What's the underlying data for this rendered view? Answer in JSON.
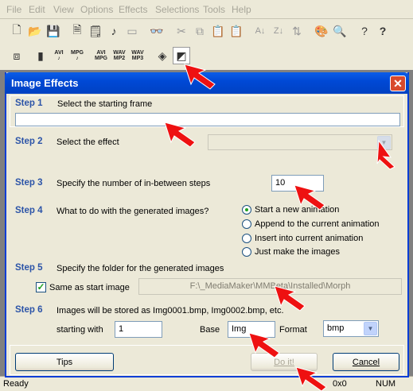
{
  "menu": [
    "File",
    "Edit",
    "View",
    "Options",
    "Effects",
    "Selections",
    "Tools",
    "Help"
  ],
  "toolbar2": [
    {
      "top": "AVI",
      "bottom": "♪"
    },
    {
      "top": "MPG",
      "bottom": "♪"
    },
    {
      "top": "AVI",
      "bottom": "MPG"
    },
    {
      "top": "WAV",
      "bottom": "MP2"
    },
    {
      "top": "WAV",
      "bottom": "MP3"
    }
  ],
  "dialog": {
    "title": "Image Effects",
    "step1": {
      "label": "Step 1",
      "text": "Select the starting frame"
    },
    "step2": {
      "label": "Step 2",
      "text": "Select the effect"
    },
    "step3": {
      "label": "Step 3",
      "text": "Specify the number of in-between steps",
      "value": "10"
    },
    "step4": {
      "label": "Step 4",
      "text": "What to do with the generated images?",
      "options": [
        "Start a new animation",
        "Append to the current animation",
        "Insert into current animation",
        "Just make the images"
      ],
      "selected": 0
    },
    "step5": {
      "label": "Step 5",
      "text": "Specify the folder for the generated images",
      "checkbox_label": "Same as start image",
      "checked": true,
      "folder": "F:\\_MediaMaker\\MMBeta\\Installed\\Morph"
    },
    "step6": {
      "label": "Step 6",
      "text": "Images will be stored as Img0001.bmp, Img0002.bmp, etc.",
      "start_label": "starting with",
      "start_value": "1",
      "base_label": "Base",
      "base_value": "Img",
      "format_label": "Format",
      "format_value": "bmp"
    },
    "tips_button": "Tips",
    "doit_button": "Do it!",
    "cancel_button": "Cancel"
  },
  "status": {
    "left": "Ready",
    "coords": "0x0",
    "num": "NUM"
  },
  "colors": {
    "annotation_arrow": "#ee1111",
    "step_label": "#2c54a8",
    "titlebar": "#0a5de8"
  }
}
